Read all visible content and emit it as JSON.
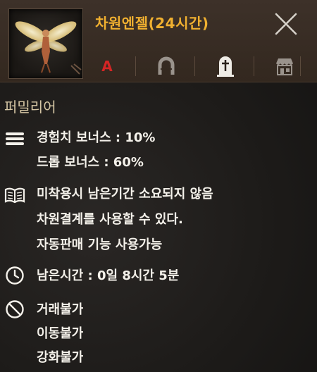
{
  "item": {
    "title": "차원엔젤(24시간)",
    "thumbnail_icon": "winged-fairy-icon",
    "title_color": "#f0b030"
  },
  "header_icons": [
    {
      "name": "grade-a",
      "label": "A",
      "color": "#d42525"
    },
    {
      "name": "horseshoe-icon"
    },
    {
      "name": "tombstone-icon"
    },
    {
      "name": "shop-icon"
    }
  ],
  "close_icon": "close-icon",
  "category": "퍼밀리어",
  "bonus": {
    "icon": "menu-lines-icon",
    "exp": "경험치 보너스 : 10%",
    "drop": "드롭 보너스 : 60%"
  },
  "description": {
    "icon": "book-icon",
    "lines": [
      "미착용시 남은기간 소요되지 않음",
      "차원결계를 사용할 수 있다.",
      "자동판매 기능 사용가능"
    ]
  },
  "time": {
    "icon": "clock-icon",
    "text": "남은시간 : 0일 8시간 5분"
  },
  "restrictions": {
    "icon": "prohibited-icon",
    "lines": [
      "거래불가",
      "이동불가",
      "강화불가"
    ]
  }
}
